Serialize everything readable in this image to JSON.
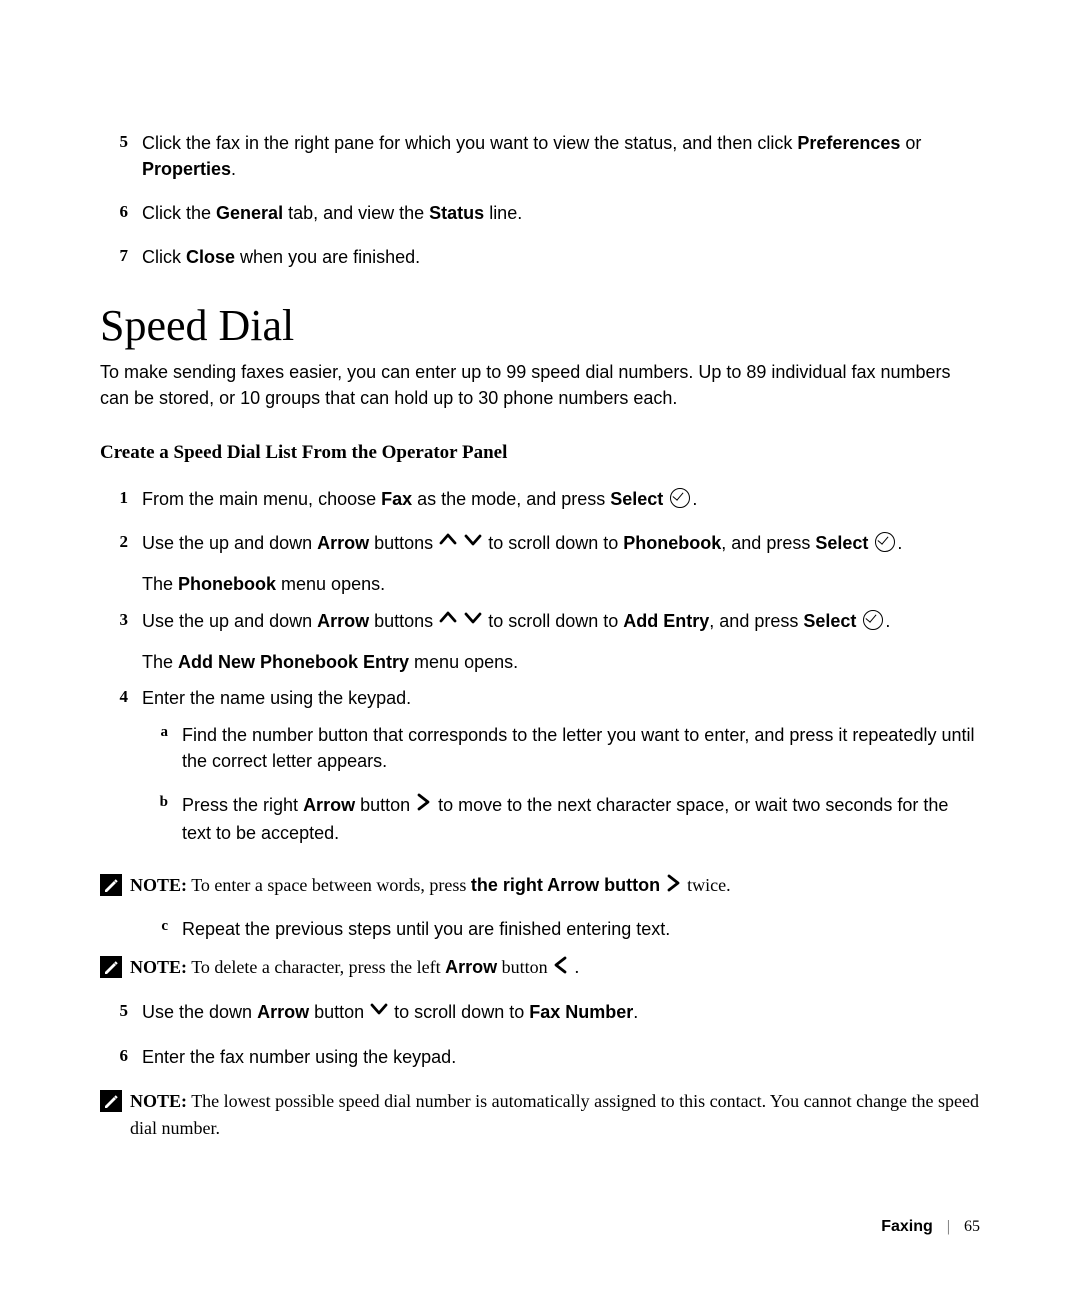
{
  "top_steps": [
    {
      "n": "5",
      "pre": "Click the fax in the right pane for which you want to view the status, and then click ",
      "bold1": "Preferences",
      "mid": " or ",
      "bold2": "Properties",
      "post": "."
    },
    {
      "n": "6",
      "pre": "Click the ",
      "bold1": "General",
      "mid": " tab, and view the ",
      "bold2": "Status",
      "post": " line."
    },
    {
      "n": "7",
      "pre": "Click ",
      "bold1": "Close",
      "mid": " when you are finished.",
      "bold2": "",
      "post": ""
    }
  ],
  "heading": "Speed Dial",
  "intro": "To make sending faxes easier, you can enter up to 99 speed dial numbers. Up to 89 individual fax numbers can be stored, or 10 groups that can hold up to 30 phone numbers each.",
  "subhead": "Create a Speed Dial List From the Operator Panel",
  "step1": {
    "n": "1",
    "pre": "From the main menu, choose ",
    "bold1": "Fax",
    "mid": " as the mode, and press ",
    "bold2": "Select",
    "post": "."
  },
  "step2": {
    "n": "2",
    "pre": "Use the up and down ",
    "bold1": "Arrow",
    "mid1": " buttons ",
    "icons": "updown",
    "mid2": " to scroll down to ",
    "bold2": "Phonebook",
    "mid3": ", and press ",
    "bold3": "Select",
    "post": ".",
    "after": "The ",
    "after_bold": "Phonebook",
    "after2": " menu opens."
  },
  "step3": {
    "n": "3",
    "pre": "Use the up and down ",
    "bold1": "Arrow",
    "mid1": " buttons ",
    "icons": "updown",
    "mid2": " to scroll down to ",
    "bold2": "Add Entry",
    "mid3": ", and press ",
    "bold3": "Select",
    "post": ".",
    "after": "The ",
    "after_bold": "Add New Phonebook Entry",
    "after2": " menu opens."
  },
  "step4": {
    "n": "4",
    "text": "Enter the name using the keypad."
  },
  "sub_a": {
    "m": "a",
    "text": "Find the number button that corresponds to the letter you want to enter, and press it repeatedly until the correct letter appears."
  },
  "sub_b": {
    "m": "b",
    "pre": "Press the right ",
    "bold1": "Arrow",
    "mid": " button ",
    "icon": "right",
    "post": " to move to the next character space, or wait two seconds for the text to be accepted."
  },
  "note1": {
    "label": "NOTE:",
    "pre": " To enter a space between words, press ",
    "bold": "the right Arrow button",
    "icon": "right",
    "post": " twice."
  },
  "sub_c": {
    "m": "c",
    "text": "Repeat the previous steps until you are finished entering text."
  },
  "note2": {
    "label": "NOTE:",
    "pre": " To delete a character, press the left ",
    "bold": "Arrow",
    "mid": " button ",
    "icon": "left",
    "post": "."
  },
  "step5": {
    "n": "5",
    "pre": "Use the down ",
    "bold1": "Arrow",
    "mid": " button ",
    "icon": "down",
    "mid2": " to scroll down to ",
    "bold2": "Fax Number",
    "post": "."
  },
  "step6": {
    "n": "6",
    "text": "Enter the fax number using the keypad."
  },
  "note3": {
    "label": "NOTE:",
    "text": " The lowest possible speed dial number is automatically assigned to this contact. You cannot change the speed dial number."
  },
  "footer": {
    "section": "Faxing",
    "page": "65"
  }
}
